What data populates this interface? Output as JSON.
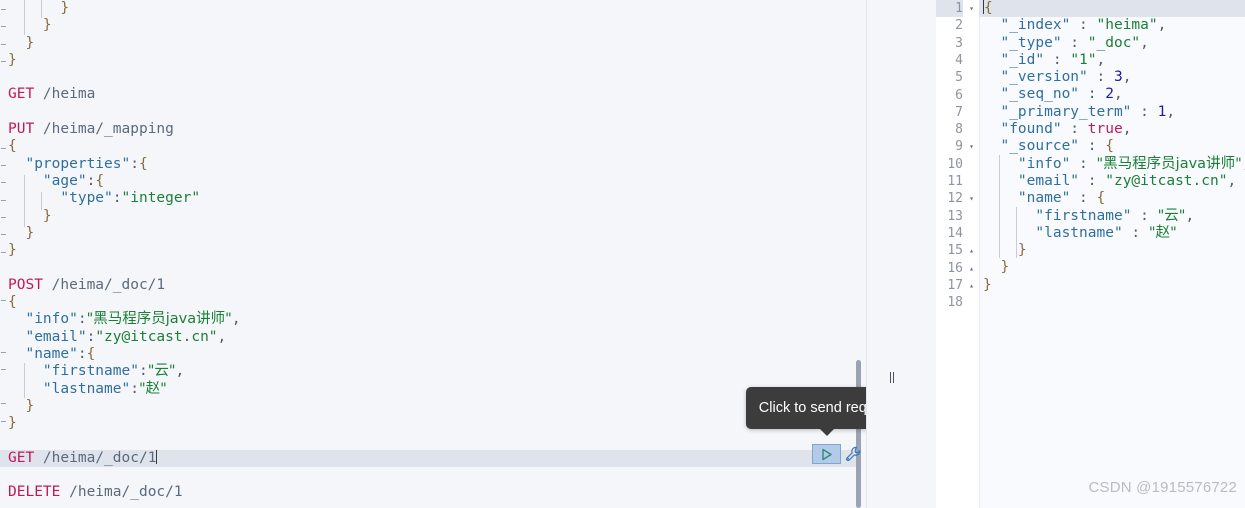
{
  "editor": {
    "name": "kibana-dev-tools-console",
    "left_pane": {
      "name": "request-editor",
      "lines": [
        {
          "id": "l1",
          "segments": [
            {
              "t": "      }",
              "c": "brace"
            }
          ]
        },
        {
          "id": "l2",
          "segments": [
            {
              "t": "    }",
              "c": "brace"
            }
          ]
        },
        {
          "id": "l3",
          "segments": [
            {
              "t": "  }",
              "c": "brace"
            }
          ]
        },
        {
          "id": "l4",
          "segments": [
            {
              "t": "}",
              "c": "brace"
            }
          ]
        },
        {
          "id": "l5",
          "segments": []
        },
        {
          "id": "l6",
          "segments": [
            {
              "t": "GET",
              "c": "kw-method"
            },
            {
              "t": " /heima",
              "c": "url"
            }
          ]
        },
        {
          "id": "l7",
          "segments": []
        },
        {
          "id": "l8",
          "segments": [
            {
              "t": "PUT",
              "c": "kw-method"
            },
            {
              "t": " /heima/_mapping",
              "c": "url"
            }
          ]
        },
        {
          "id": "l9",
          "segments": [
            {
              "t": "{",
              "c": "brace"
            }
          ]
        },
        {
          "id": "l10",
          "segments": [
            {
              "t": "  ",
              "c": "jpunct"
            },
            {
              "t": "\"properties\"",
              "c": "jkey"
            },
            {
              "t": ":",
              "c": "jpunct"
            },
            {
              "t": "{",
              "c": "brace"
            }
          ]
        },
        {
          "id": "l11",
          "segments": [
            {
              "t": "    ",
              "c": "jpunct"
            },
            {
              "t": "\"age\"",
              "c": "jkey"
            },
            {
              "t": ":",
              "c": "jpunct"
            },
            {
              "t": "{",
              "c": "brace"
            }
          ]
        },
        {
          "id": "l12",
          "segments": [
            {
              "t": "      ",
              "c": "jpunct"
            },
            {
              "t": "\"type\"",
              "c": "jkey"
            },
            {
              "t": ":",
              "c": "jpunct"
            },
            {
              "t": "\"integer\"",
              "c": "jstr"
            }
          ]
        },
        {
          "id": "l13",
          "segments": [
            {
              "t": "    }",
              "c": "brace"
            }
          ]
        },
        {
          "id": "l14",
          "segments": [
            {
              "t": "  }",
              "c": "brace"
            }
          ]
        },
        {
          "id": "l15",
          "segments": [
            {
              "t": "}",
              "c": "brace"
            }
          ]
        },
        {
          "id": "l16",
          "segments": []
        },
        {
          "id": "l17",
          "segments": [
            {
              "t": "POST",
              "c": "kw-method"
            },
            {
              "t": " /heima/_doc/1",
              "c": "url"
            }
          ]
        },
        {
          "id": "l18",
          "segments": [
            {
              "t": "{",
              "c": "brace"
            }
          ]
        },
        {
          "id": "l19",
          "segments": [
            {
              "t": "  ",
              "c": "jpunct"
            },
            {
              "t": "\"info\"",
              "c": "jkey"
            },
            {
              "t": ":",
              "c": "jpunct"
            },
            {
              "t": "\"黑马程序员java讲师\"",
              "c": "jstr cjk"
            },
            {
              "t": ",",
              "c": "jpunct"
            }
          ]
        },
        {
          "id": "l20",
          "segments": [
            {
              "t": "  ",
              "c": "jpunct"
            },
            {
              "t": "\"email\"",
              "c": "jkey"
            },
            {
              "t": ":",
              "c": "jpunct"
            },
            {
              "t": "\"zy@itcast.cn\"",
              "c": "jstr"
            },
            {
              "t": ",",
              "c": "jpunct"
            }
          ]
        },
        {
          "id": "l21",
          "segments": [
            {
              "t": "  ",
              "c": "jpunct"
            },
            {
              "t": "\"name\"",
              "c": "jkey"
            },
            {
              "t": ":",
              "c": "jpunct"
            },
            {
              "t": "{",
              "c": "brace"
            }
          ]
        },
        {
          "id": "l22",
          "segments": [
            {
              "t": "    ",
              "c": "jpunct"
            },
            {
              "t": "\"firstname\"",
              "c": "jkey"
            },
            {
              "t": ":",
              "c": "jpunct"
            },
            {
              "t": "\"云\"",
              "c": "jstr cjk"
            },
            {
              "t": ",",
              "c": "jpunct"
            }
          ]
        },
        {
          "id": "l23",
          "segments": [
            {
              "t": "    ",
              "c": "jpunct"
            },
            {
              "t": "\"lastname\"",
              "c": "jkey"
            },
            {
              "t": ":",
              "c": "jpunct"
            },
            {
              "t": "\"赵\"",
              "c": "jstr cjk"
            }
          ]
        },
        {
          "id": "l24",
          "segments": [
            {
              "t": "  }",
              "c": "brace"
            }
          ]
        },
        {
          "id": "l25",
          "segments": [
            {
              "t": "}",
              "c": "brace"
            }
          ]
        },
        {
          "id": "l26",
          "segments": []
        },
        {
          "id": "l27",
          "active": true,
          "caret": true,
          "segments": [
            {
              "t": "GET",
              "c": "kw-method"
            },
            {
              "t": " /heima/_doc/1",
              "c": "url"
            }
          ]
        },
        {
          "id": "l28",
          "segments": []
        },
        {
          "id": "l29",
          "segments": [
            {
              "t": "DELETE",
              "c": "kw-method"
            },
            {
              "t": " /heima/_doc/1",
              "c": "url"
            }
          ]
        }
      ]
    },
    "right_pane": {
      "name": "response-viewer",
      "lines": [
        {
          "num": "1",
          "fold": "▾",
          "active": true,
          "caret": "before",
          "segments": [
            {
              "t": "{",
              "c": "brace"
            }
          ]
        },
        {
          "num": "2",
          "fold": "",
          "segments": [
            {
              "t": "  ",
              "c": "jpunct"
            },
            {
              "t": "\"_index\"",
              "c": "jkey"
            },
            {
              "t": " : ",
              "c": "jpunct"
            },
            {
              "t": "\"heima\"",
              "c": "jstr"
            },
            {
              "t": ",",
              "c": "jpunct"
            }
          ]
        },
        {
          "num": "3",
          "fold": "",
          "segments": [
            {
              "t": "  ",
              "c": "jpunct"
            },
            {
              "t": "\"_type\"",
              "c": "jkey"
            },
            {
              "t": " : ",
              "c": "jpunct"
            },
            {
              "t": "\"_doc\"",
              "c": "jstr"
            },
            {
              "t": ",",
              "c": "jpunct"
            }
          ]
        },
        {
          "num": "4",
          "fold": "",
          "segments": [
            {
              "t": "  ",
              "c": "jpunct"
            },
            {
              "t": "\"_id\"",
              "c": "jkey"
            },
            {
              "t": " : ",
              "c": "jpunct"
            },
            {
              "t": "\"1\"",
              "c": "jstr"
            },
            {
              "t": ",",
              "c": "jpunct"
            }
          ]
        },
        {
          "num": "5",
          "fold": "",
          "segments": [
            {
              "t": "  ",
              "c": "jpunct"
            },
            {
              "t": "\"_version\"",
              "c": "jkey"
            },
            {
              "t": " : ",
              "c": "jpunct"
            },
            {
              "t": "3",
              "c": "jnum"
            },
            {
              "t": ",",
              "c": "jpunct"
            }
          ]
        },
        {
          "num": "6",
          "fold": "",
          "segments": [
            {
              "t": "  ",
              "c": "jpunct"
            },
            {
              "t": "\"_seq_no\"",
              "c": "jkey"
            },
            {
              "t": " : ",
              "c": "jpunct"
            },
            {
              "t": "2",
              "c": "jnum"
            },
            {
              "t": ",",
              "c": "jpunct"
            }
          ]
        },
        {
          "num": "7",
          "fold": "",
          "segments": [
            {
              "t": "  ",
              "c": "jpunct"
            },
            {
              "t": "\"_primary_term\"",
              "c": "jkey"
            },
            {
              "t": " : ",
              "c": "jpunct"
            },
            {
              "t": "1",
              "c": "jnum"
            },
            {
              "t": ",",
              "c": "jpunct"
            }
          ]
        },
        {
          "num": "8",
          "fold": "",
          "segments": [
            {
              "t": "  ",
              "c": "jpunct"
            },
            {
              "t": "\"found\"",
              "c": "jkey"
            },
            {
              "t": " : ",
              "c": "jpunct"
            },
            {
              "t": "true",
              "c": "jbool"
            },
            {
              "t": ",",
              "c": "jpunct"
            }
          ]
        },
        {
          "num": "9",
          "fold": "▾",
          "segments": [
            {
              "t": "  ",
              "c": "jpunct"
            },
            {
              "t": "\"_source\"",
              "c": "jkey"
            },
            {
              "t": " : ",
              "c": "jpunct"
            },
            {
              "t": "{",
              "c": "brace"
            }
          ]
        },
        {
          "num": "10",
          "fold": "",
          "segments": [
            {
              "t": "    ",
              "c": "jpunct"
            },
            {
              "t": "\"info\"",
              "c": "jkey"
            },
            {
              "t": " : ",
              "c": "jpunct"
            },
            {
              "t": "\"黑马程序员java讲师\"",
              "c": "jstr cjk"
            },
            {
              "t": ",",
              "c": "jpunct"
            }
          ]
        },
        {
          "num": "11",
          "fold": "",
          "segments": [
            {
              "t": "    ",
              "c": "jpunct"
            },
            {
              "t": "\"email\"",
              "c": "jkey"
            },
            {
              "t": " : ",
              "c": "jpunct"
            },
            {
              "t": "\"zy@itcast.cn\"",
              "c": "jstr"
            },
            {
              "t": ",",
              "c": "jpunct"
            }
          ]
        },
        {
          "num": "12",
          "fold": "▾",
          "segments": [
            {
              "t": "    ",
              "c": "jpunct"
            },
            {
              "t": "\"name\"",
              "c": "jkey"
            },
            {
              "t": " : ",
              "c": "jpunct"
            },
            {
              "t": "{",
              "c": "brace"
            }
          ]
        },
        {
          "num": "13",
          "fold": "",
          "segments": [
            {
              "t": "      ",
              "c": "jpunct"
            },
            {
              "t": "\"firstname\"",
              "c": "jkey"
            },
            {
              "t": " : ",
              "c": "jpunct"
            },
            {
              "t": "\"云\"",
              "c": "jstr cjk"
            },
            {
              "t": ",",
              "c": "jpunct"
            }
          ]
        },
        {
          "num": "14",
          "fold": "",
          "segments": [
            {
              "t": "      ",
              "c": "jpunct"
            },
            {
              "t": "\"lastname\"",
              "c": "jkey"
            },
            {
              "t": " : ",
              "c": "jpunct"
            },
            {
              "t": "\"赵\"",
              "c": "jstr cjk"
            }
          ]
        },
        {
          "num": "15",
          "fold": "▴",
          "segments": [
            {
              "t": "    }",
              "c": "brace"
            }
          ]
        },
        {
          "num": "16",
          "fold": "▴",
          "segments": [
            {
              "t": "  }",
              "c": "brace"
            }
          ]
        },
        {
          "num": "17",
          "fold": "▴",
          "segments": [
            {
              "t": "}",
              "c": "brace"
            }
          ]
        },
        {
          "num": "18",
          "fold": "",
          "segments": []
        }
      ]
    }
  },
  "tooltip": {
    "name": "send-request-tooltip",
    "text": "Click to send request"
  },
  "actions": {
    "run_icon": "play-triangle-icon",
    "run_label": "",
    "wrench_icon": "wrench-icon",
    "wrench_label": ""
  },
  "watermark": {
    "text": "CSDN @1915576722"
  },
  "colors": {
    "pane_bg": "#f5f6fa",
    "gutter_bg": "#ffffff",
    "active_line": "#dfe3ec",
    "method_keyword": "#c2185b",
    "json_key": "#2f6f9f",
    "json_string": "#1a7f37",
    "json_number": "#1a1aa6",
    "json_bool": "#c2185b",
    "brace": "#8a6d3b",
    "tooltip_bg": "#3c3c3c",
    "run_btn_bg": "#b3cbe8",
    "run_triangle": "#2e8b7a",
    "wrench": "#3f78c2",
    "scrollbar": "#9aa2b4",
    "watermark": "#b9bcc6"
  }
}
